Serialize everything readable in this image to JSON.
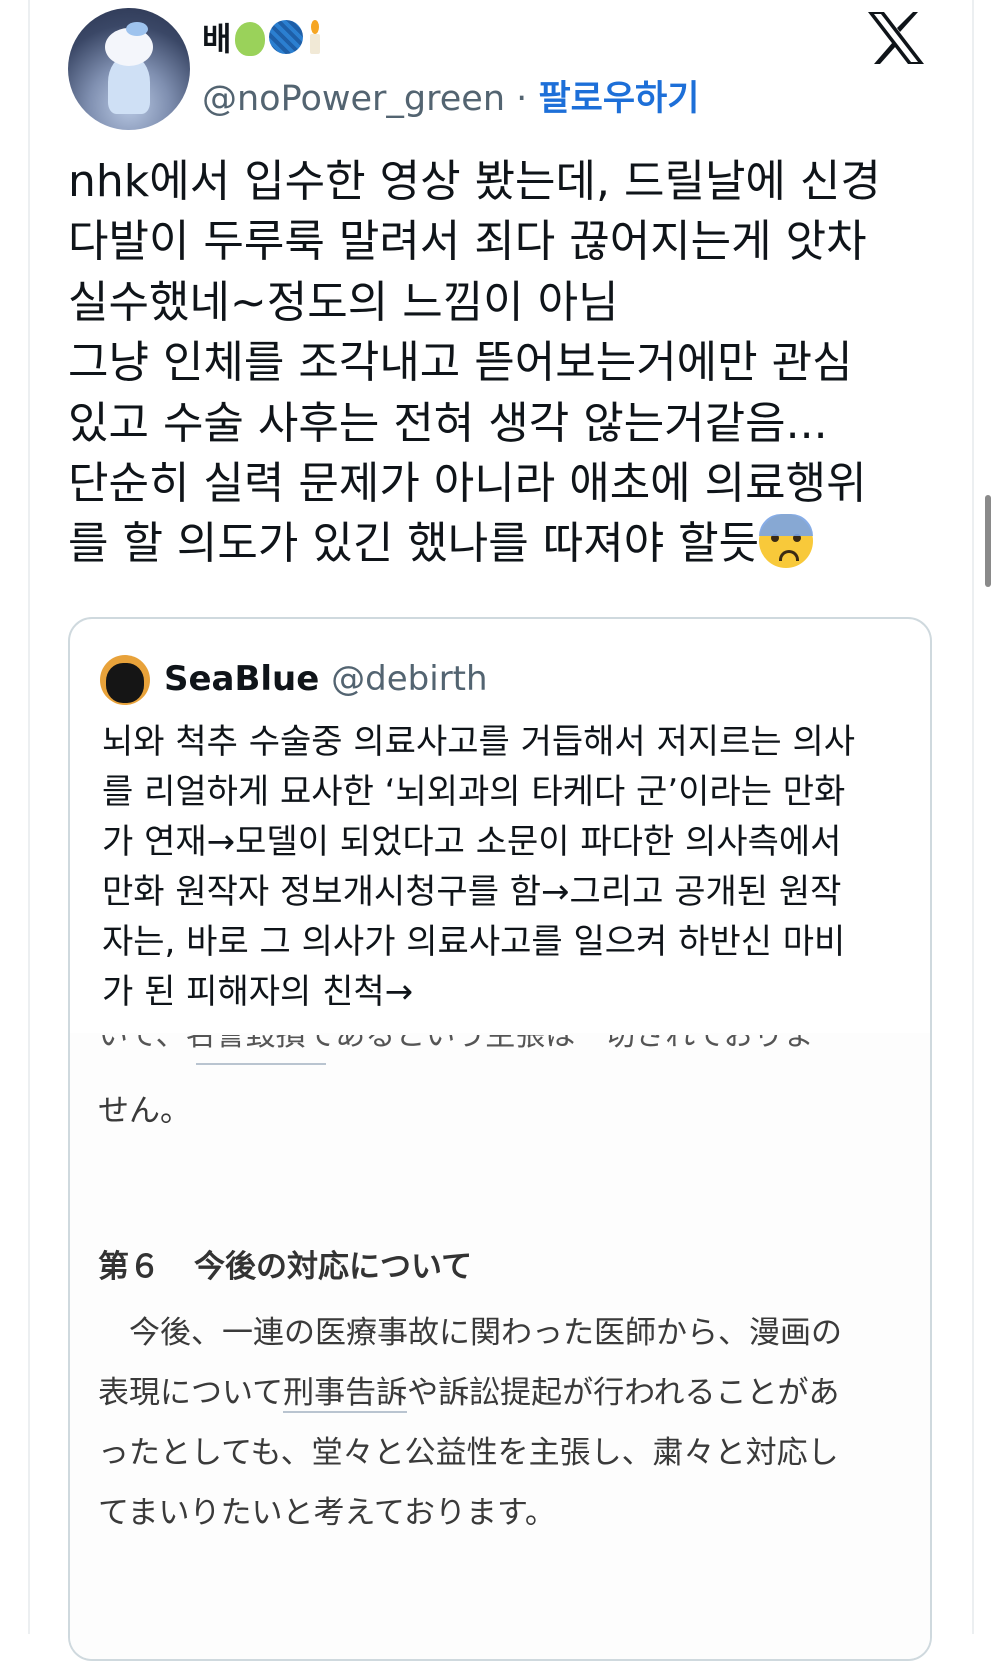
{
  "author": {
    "display_name": "배",
    "emojis": [
      "pear-icon",
      "yarn-icon",
      "candle-icon"
    ],
    "handle": "@noPower_green",
    "separator": "·",
    "follow_label": "팔로우하기"
  },
  "tweet": {
    "lines": [
      "nhk에서 입수한 영상 봤는데, 드릴날에 신경",
      "다발이 두루룩 말려서 죄다 끊어지는게 앗차",
      "실수했네~정도의 느낌이 아님",
      "그냥 인체를 조각내고 뜯어보는거에만 관심",
      "있고 수술 사후는 전혀 생각 않는거같음...",
      "단순히 실력 문제가 아니라 애초에 의료행위",
      "를 할 의도가 있긴 했나를 따져야 할듯"
    ]
  },
  "quote": {
    "name": "SeaBlue",
    "handle": "@debirth",
    "text": "뇌와 척추 수술중 의료사고를 거듭해서 저지르는 의사\n를 리얼하게 묘사한 ‘뇌외과의 타케다 군’이라는 만화\n가 연재→모델이 되었다고 소문이 파다한 의사측에서\n만화 원작자 정보개시청구를 함→그리고 공개된 원작\n자는, 바로 그 의사가 의료사고를 일으켜 하반신 마비\n가 된 피해자의 친척→"
  },
  "document": {
    "cut_line": "いて、名誉毀損であるという主張は一切されておりま",
    "line2": "せん。",
    "heading_num": "第６",
    "heading_text": "今後の対応について",
    "para_1": "　今後、一連の医療事故に関わった医師から、漫画の",
    "para_2a": "表現について",
    "para_2b": "刑事告訴",
    "para_2c": "や訴訟提起が行われることがあ",
    "para_3": "ったとしても、堂々と公益性を主張し、粛々と対応し",
    "para_4": "てまいりたいと考えております。"
  }
}
